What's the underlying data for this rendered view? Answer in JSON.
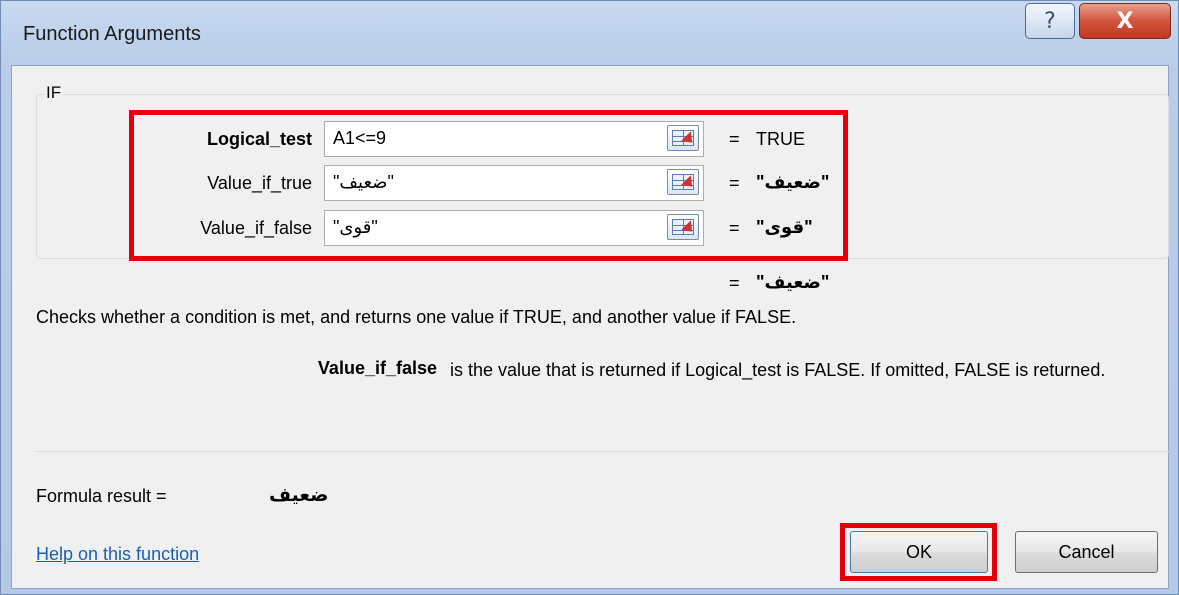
{
  "window": {
    "title": "Function Arguments",
    "help_glyph": "?",
    "close_glyph": "X"
  },
  "function": {
    "name": "IF",
    "arguments": [
      {
        "label": "Logical_test",
        "value": "A1<=9",
        "result": "TRUE"
      },
      {
        "label": "Value_if_true",
        "value": "\"ضعيف\"",
        "result": "\"ضعيف\""
      },
      {
        "label": "Value_if_false",
        "value": "\"قوى\"",
        "result": "\"قوى\""
      }
    ],
    "equals_sign": "=",
    "overall_result": "\"ضعيف\"",
    "description": "Checks whether a condition is met, and returns one value if TRUE, and another value if FALSE.",
    "param_name": "Value_if_false",
    "param_description": "is the value that is returned if Logical_test is FALSE. If omitted, FALSE is returned."
  },
  "formula": {
    "label": "Formula result =",
    "value": "ضعيف"
  },
  "footer": {
    "help_link": "Help on this function",
    "ok_label": "OK",
    "cancel_label": "Cancel"
  },
  "colors": {
    "highlight_red": "#e6000a",
    "link_blue": "#1a5fb4"
  }
}
